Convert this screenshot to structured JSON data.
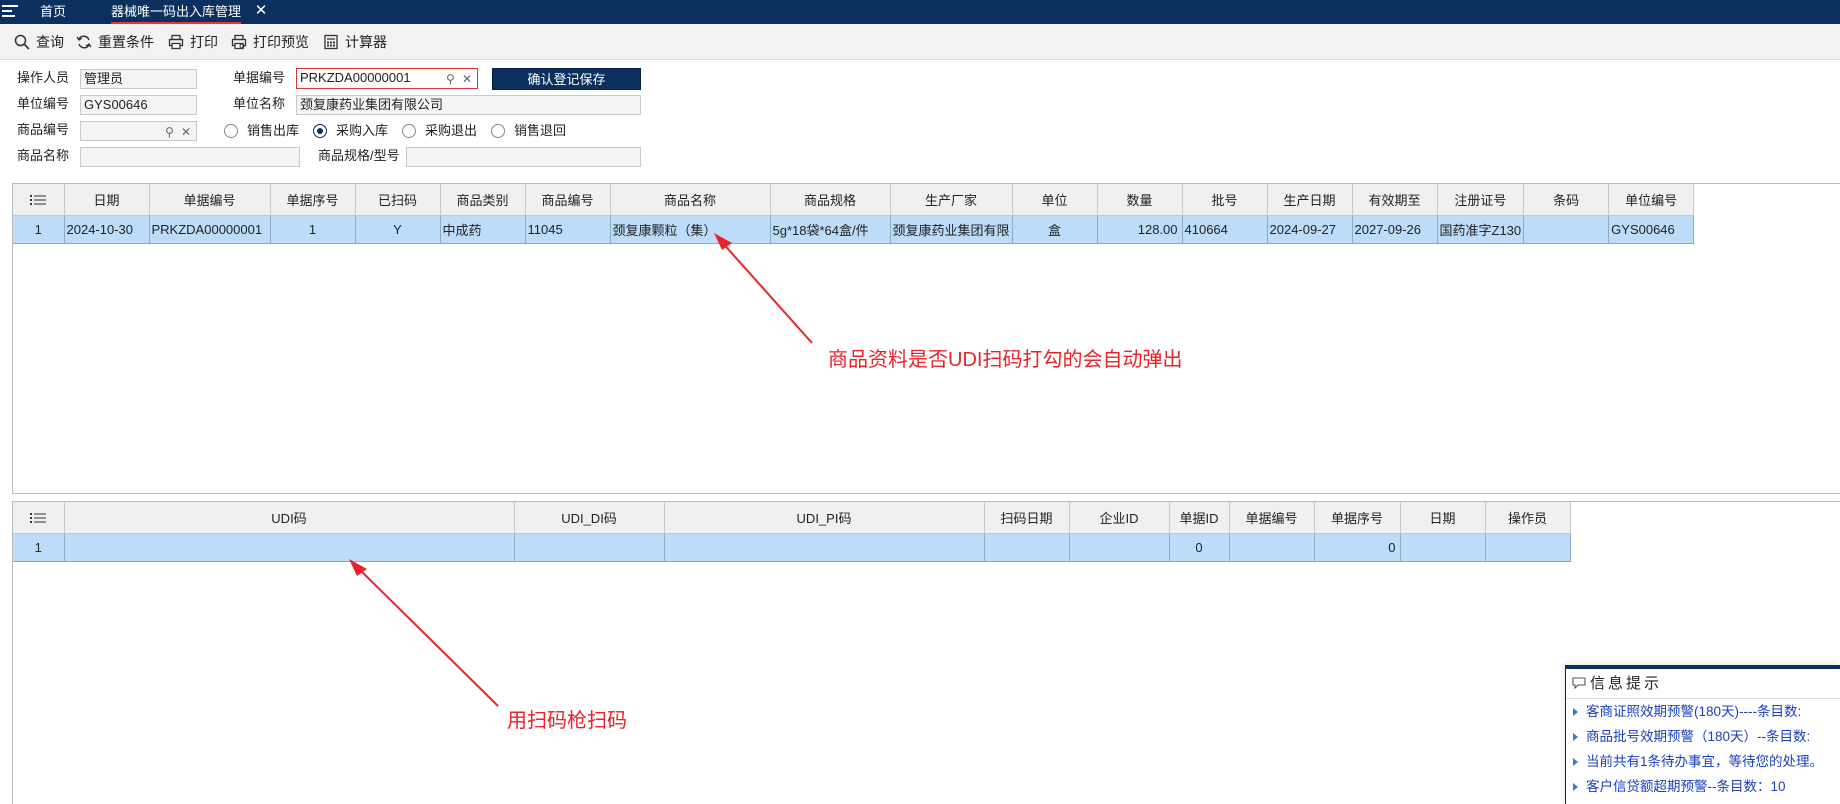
{
  "tabs": {
    "home": "首页",
    "active": "器械唯一码出入库管理"
  },
  "toolbar": {
    "query": "查询",
    "reset": "重置条件",
    "print": "打印",
    "print_preview": "打印预览",
    "calculator": "计算器"
  },
  "form": {
    "operator_label": "操作人员",
    "operator_value": "管理员",
    "docno_label": "单据编号",
    "docno_value": "PRKZDA00000001",
    "save_button": "确认登记保存",
    "unit_code_label": "单位编号",
    "unit_code_value": "GYS00646",
    "unit_name_label": "单位名称",
    "unit_name_value": "颈复康药业集团有限公司",
    "product_code_label": "商品编号",
    "product_code_value": "",
    "product_name_label": "商品名称",
    "product_name_value": "",
    "spec_label": "商品规格/型号",
    "spec_value": "",
    "radios": [
      {
        "label": "销售出库",
        "checked": false
      },
      {
        "label": "采购入库",
        "checked": true
      },
      {
        "label": "采购退出",
        "checked": false
      },
      {
        "label": "销售退回",
        "checked": false
      }
    ]
  },
  "grid1": {
    "headers": [
      "日期",
      "单据编号",
      "单据序号",
      "已扫码",
      "商品类别",
      "商品编号",
      "商品名称",
      "商品规格",
      "生产厂家",
      "单位",
      "数量",
      "批号",
      "生产日期",
      "有效期至",
      "注册证号",
      "条码",
      "单位编号"
    ],
    "row": {
      "index": "1",
      "date": "2024-10-30",
      "docno": "PRKZDA00000001",
      "seq": "1",
      "scanned": "Y",
      "category": "中成药",
      "product_code": "11045",
      "product_name": "颈复康颗粒（集）",
      "spec": "5g*18袋*64盒/件",
      "manufacturer": "颈复康药业集团有限",
      "unit": "盒",
      "qty": "128.00",
      "batch": "410664",
      "mfg_date": "2024-09-27",
      "expiry": "2027-09-26",
      "reg_no": "国药准字Z130",
      "barcode": "",
      "unit_code": "GYS00646"
    }
  },
  "grid2": {
    "headers": [
      "UDI码",
      "UDI_DI码",
      "UDI_PI码",
      "扫码日期",
      "企业ID",
      "单据ID",
      "单据编号",
      "单据序号",
      "日期",
      "操作员"
    ],
    "row": {
      "index": "1",
      "udi": "",
      "udi_di": "",
      "udi_pi": "",
      "scan_date": "",
      "company_id": "",
      "doc_id": "0",
      "docno": "",
      "seq": "0",
      "date": "",
      "operator": ""
    }
  },
  "annotations": {
    "note1": "商品资料是否UDI扫码打勾的会自动弹出",
    "note2": "用扫码枪扫码"
  },
  "info": {
    "title": "信息提示",
    "items": [
      "客商证照效期预警(180天)----条目数:",
      "商品批号效期预警（180天）--条目数:",
      "当前共有1条待办事宜，等待您的处理。",
      "客户信贷额超期预警--条目数：10"
    ]
  },
  "colors": {
    "navy": "#0b2f5f",
    "selected_row": "#bcdcfa",
    "annotation": "#e8232a",
    "info_link": "#1a3fbf"
  }
}
